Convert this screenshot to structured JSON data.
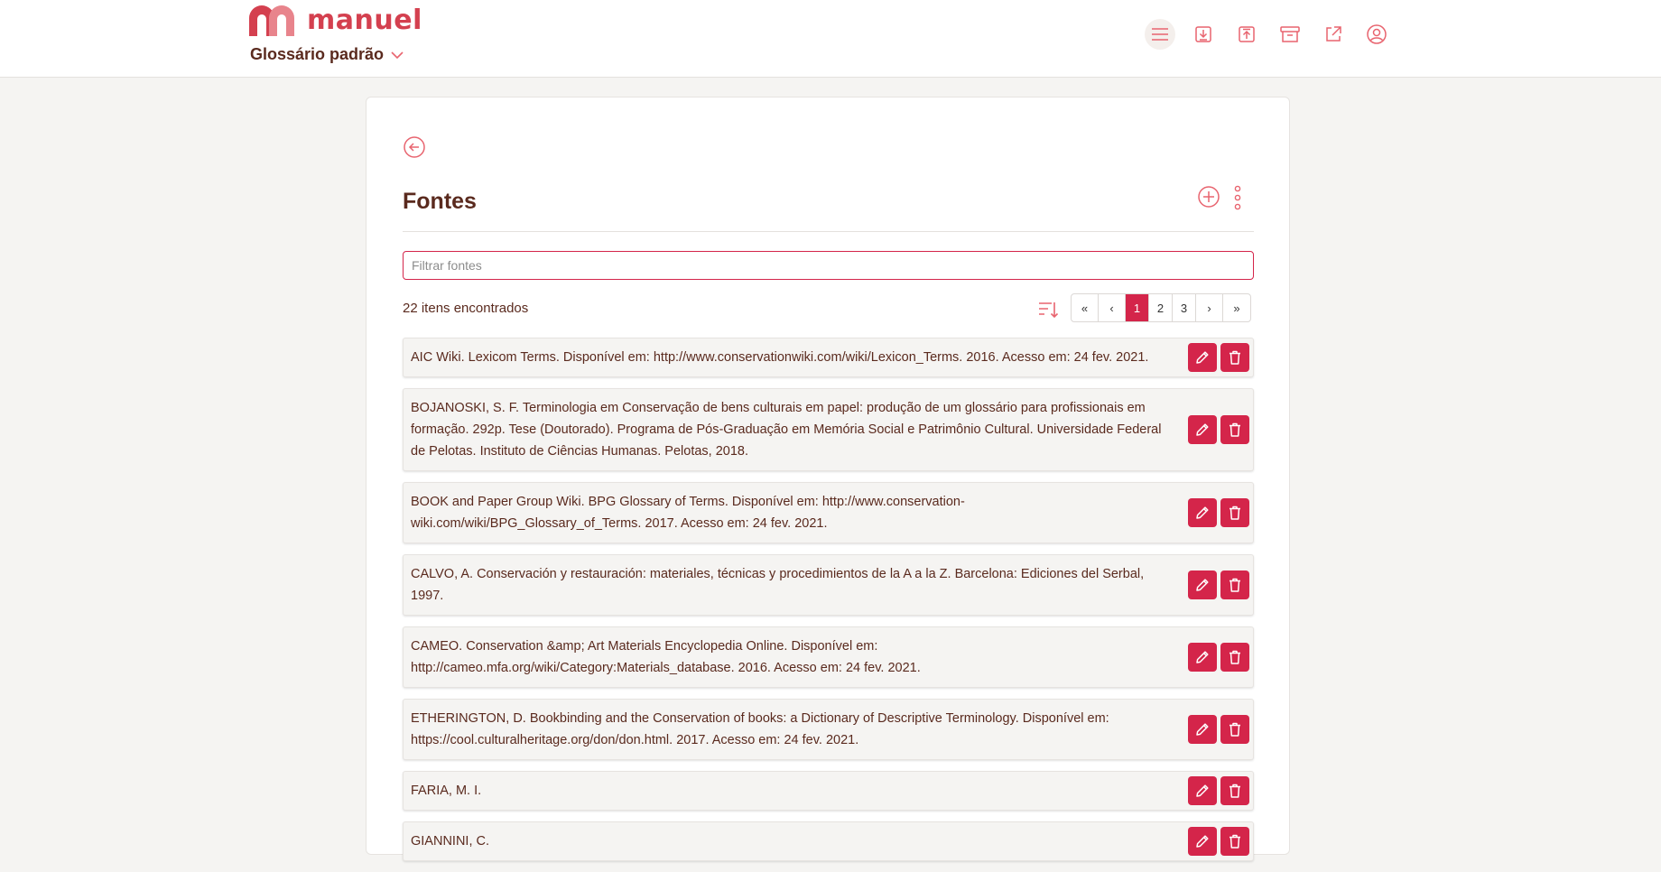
{
  "app": {
    "brand": "manuel",
    "glossary_label": "Glossário padrão"
  },
  "toolbar_icons": [
    "menu-icon",
    "download-icon",
    "upload-icon",
    "archive-icon",
    "external-link-icon",
    "user-icon"
  ],
  "page": {
    "title": "Fontes",
    "filter_placeholder": "Filtrar fontes",
    "filter_value": "",
    "count_text": "22 itens encontrados"
  },
  "pagination": {
    "first": "«",
    "prev": "‹",
    "pages": [
      "1",
      "2",
      "3"
    ],
    "current": "1",
    "next": "›",
    "last": "»"
  },
  "sources": [
    "AIC Wiki. Lexicom Terms. Disponível em: http://www.conservationwiki.com/wiki/Lexicon_Terms. 2016. Acesso em: 24 fev. 2021.",
    "BOJANOSKI, S. F. Terminologia em Conservação de bens culturais em papel: produção de um glossário para profissionais em formação. 292p. Tese (Doutorado). Programa de Pós-Graduação em Memória Social e Patrimônio Cultural. Universidade Federal de Pelotas. Instituto de Ciências Humanas. Pelotas, 2018.",
    "BOOK and Paper Group Wiki. BPG Glossary of Terms. Disponível em: http://www.conservation-wiki.com/wiki/BPG_Glossary_of_Terms. 2017. Acesso em: 24 fev. 2021.",
    "CALVO, A. Conservación y restauración: materiales, técnicas y procedimientos de la A a la Z. Barcelona: Ediciones del Serbal, 1997.",
    "CAMEO. Conservation &amp; Art Materials Encyclopedia Online. Disponível em: http://cameo.mfa.org/wiki/Category:Materials_database. 2016. Acesso em: 24 fev. 2021.",
    "ETHERINGTON, D. Bookbinding and the Conservation of books: a Dictionary of Descriptive Terminology. Disponível em: https://cool.culturalheritage.org/don/don.html. 2017. Acesso em: 24 fev. 2021.",
    "FARIA, M. I.",
    "GIANNINI, C."
  ],
  "colors": {
    "accent": "#d4254a",
    "accent_light": "#e8646f",
    "text": "#5a2a1e",
    "background": "#f5f4f2"
  }
}
